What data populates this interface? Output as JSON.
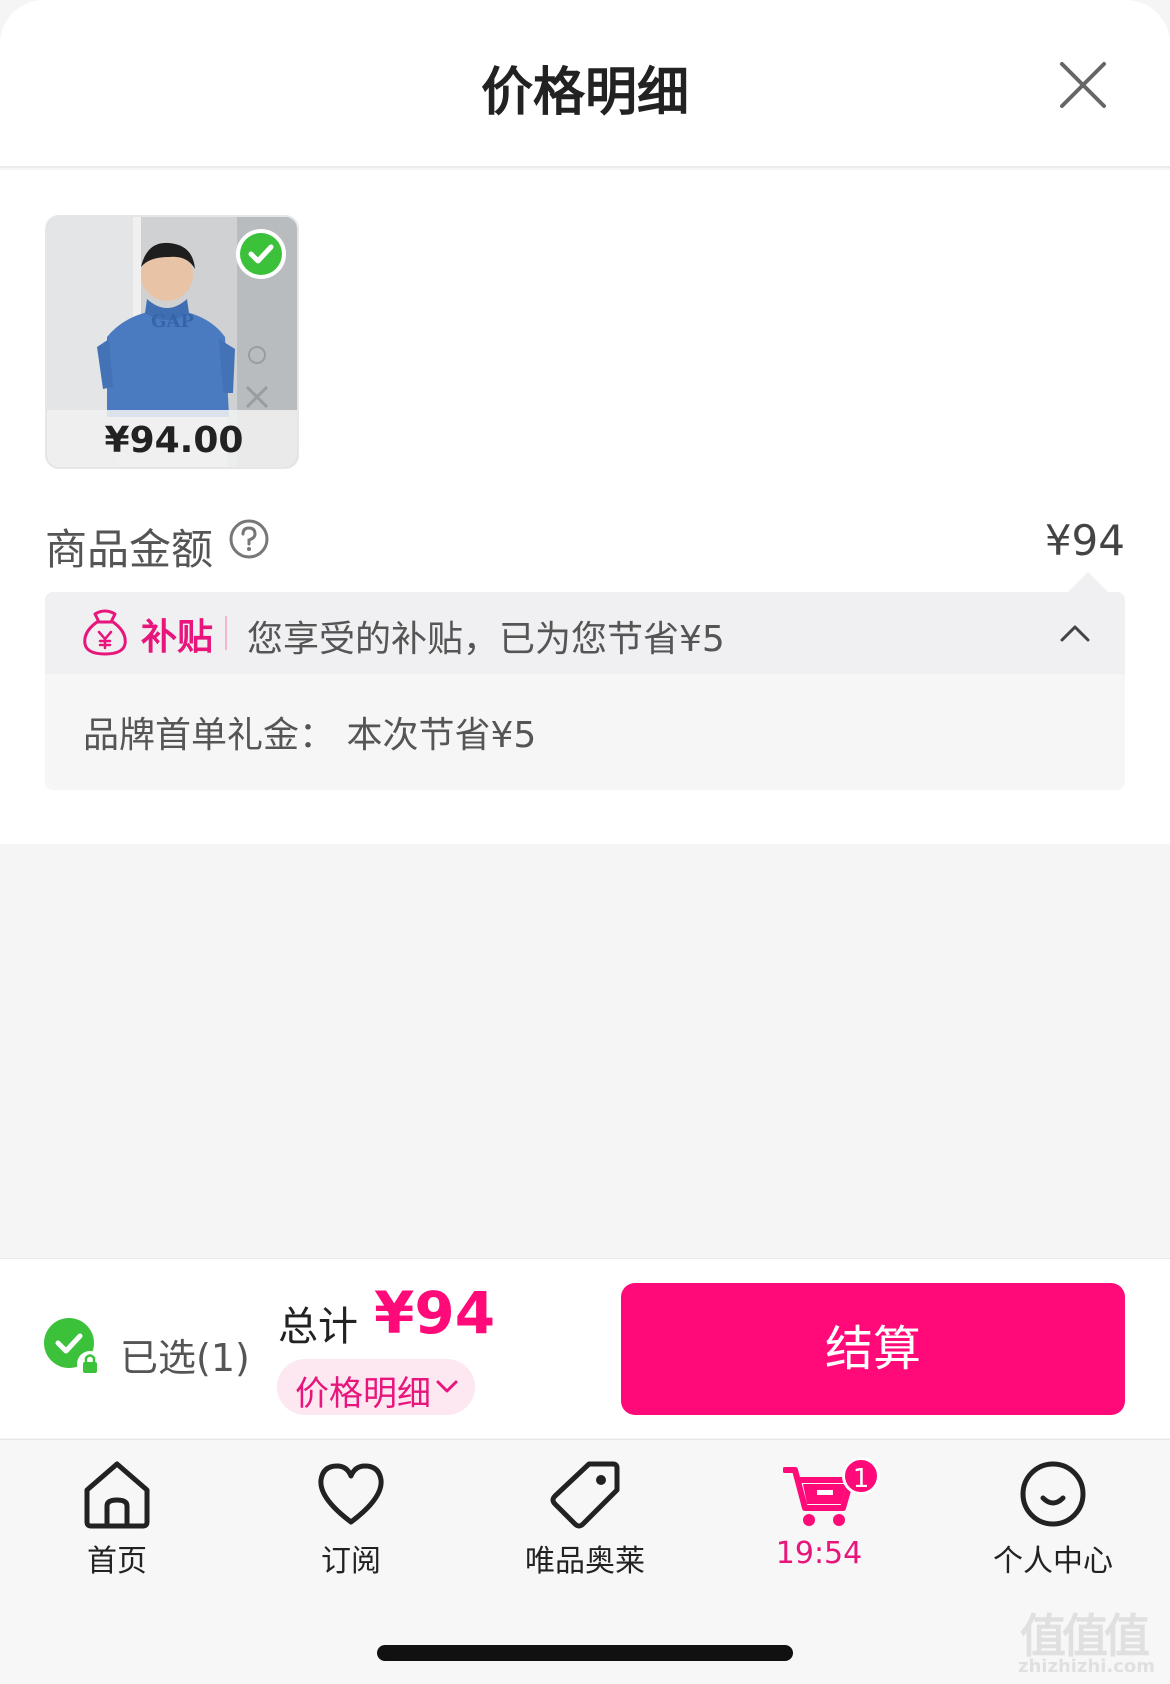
{
  "header": {
    "title": "价格明细"
  },
  "product": {
    "price": "¥94.00",
    "selected": true,
    "image": "hoodie-model-photo"
  },
  "summary": {
    "amount_label": "商品金额",
    "amount_value": "¥94",
    "subsidy_tag": "补贴",
    "subsidy_text": "您享受的补贴，已为您节省¥5",
    "subsidy_detail": "品牌首单礼金：  本次节省¥5"
  },
  "bottom": {
    "selected_text": "已选(1)",
    "total_label": "总计",
    "total_value": "¥94",
    "detail_label": "价格明细",
    "checkout_label": "结算"
  },
  "tabs": [
    {
      "label": "首页",
      "icon": "home-icon"
    },
    {
      "label": "订阅",
      "icon": "heart-icon"
    },
    {
      "label": "唯品奥莱",
      "icon": "tag-icon"
    },
    {
      "label": "19:54",
      "icon": "cart-icon",
      "badge": "1",
      "active": true
    },
    {
      "label": "个人中心",
      "icon": "smile-icon"
    }
  ],
  "watermark": {
    "glyph": "值值值",
    "url": "zhizhizhi.com"
  },
  "colors": {
    "accent": "#ff0a78",
    "check_green": "#3cc13b",
    "text": "#333333"
  }
}
